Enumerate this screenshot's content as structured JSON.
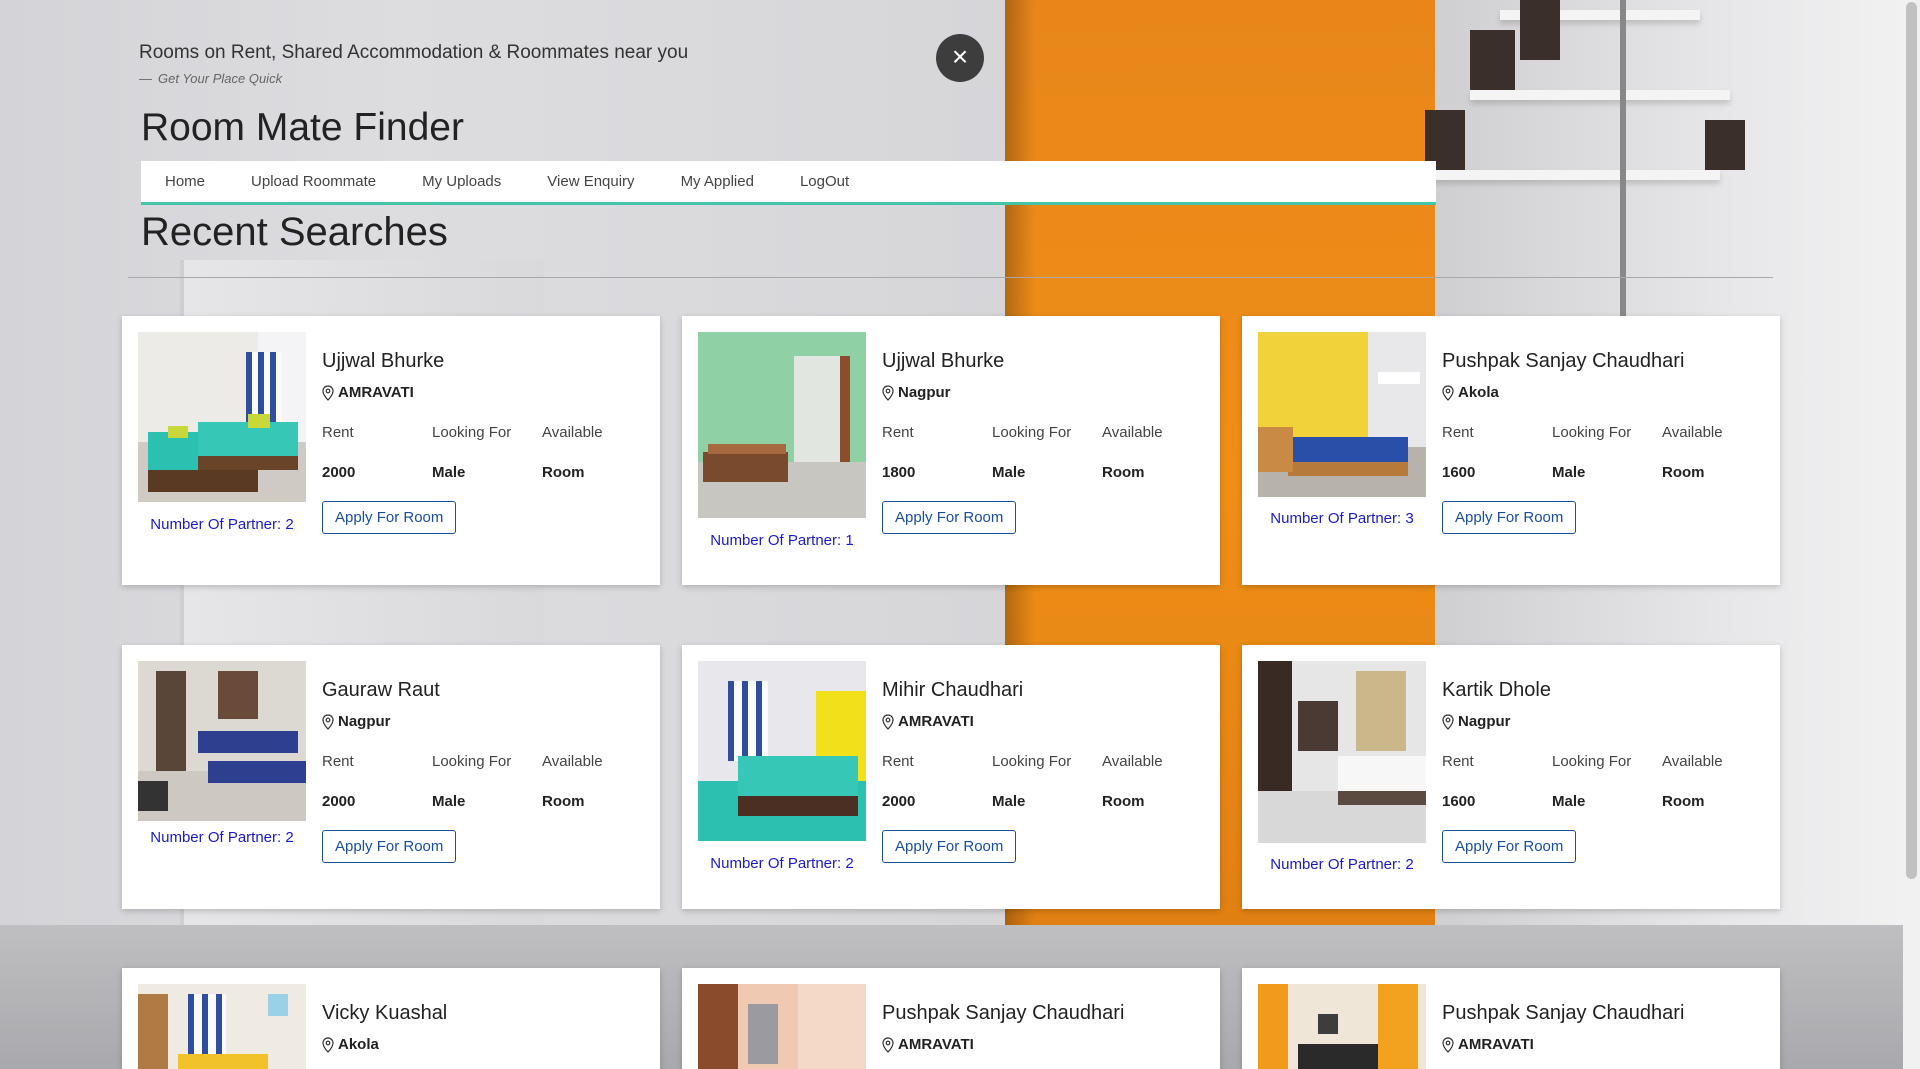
{
  "header": {
    "tagline": "Rooms on Rent, Shared Accommodation & Roommates near you",
    "subtag_prefix": "Get Your",
    "subtag_emph": "Place Quick",
    "brand": "Room Mate Finder",
    "close_glyph": "×"
  },
  "nav": {
    "items": [
      "Home",
      "Upload Roommate",
      "My Uploads",
      "View Enquiry",
      "My Applied",
      "LogOut"
    ],
    "accent_color": "#45c4a8"
  },
  "section": {
    "title": "Recent Searches"
  },
  "labels": {
    "rent": "Rent",
    "looking_for": "Looking For",
    "available": "Available",
    "apply": "Apply For Room",
    "partner_prefix": "Number Of Partner:"
  },
  "listings": [
    {
      "name": "Ujjwal Bhurke",
      "location": "AMRAVATI",
      "rent": "2000",
      "looking_for": "Male",
      "available": "Room",
      "partner_text": "Number Of Partner: 2",
      "photo": "teal-beds"
    },
    {
      "name": "Ujjwal Bhurke",
      "location": "Nagpur",
      "rent": "1800",
      "looking_for": "Male",
      "available": "Room",
      "partner_text": "Number Of Partner: 1",
      "photo": "green-room"
    },
    {
      "name": "Pushpak Sanjay Chaudhari",
      "location": "Akola",
      "rent": "1600",
      "looking_for": "Male",
      "available": "Room",
      "partner_text": "Number Of Partner: 3",
      "photo": "yellow-room"
    },
    {
      "name": "Gauraw Raut",
      "location": "Nagpur",
      "rent": "2000",
      "looking_for": "Male",
      "available": "Room",
      "partner_text": "Number Of Partner: 2",
      "photo": "blue-beds"
    },
    {
      "name": "Mihir Chaudhari",
      "location": "AMRAVATI",
      "rent": "2000",
      "looking_for": "Male",
      "available": "Room",
      "partner_text": "Number Of Partner: 2",
      "photo": "teal-beds-2"
    },
    {
      "name": "Kartik Dhole",
      "location": "Nagpur",
      "rent": "1600",
      "looking_for": "Male",
      "available": "Room",
      "partner_text": "Number Of Partner: 2",
      "photo": "white-room"
    },
    {
      "name": "Vicky Kuashal",
      "location": "Akola",
      "photo": "kids-room"
    },
    {
      "name": "Pushpak Sanjay Chaudhari",
      "location": "AMRAVATI",
      "photo": "peach-room"
    },
    {
      "name": "Pushpak Sanjay Chaudhari",
      "location": "AMRAVATI",
      "photo": "orange-room"
    }
  ]
}
